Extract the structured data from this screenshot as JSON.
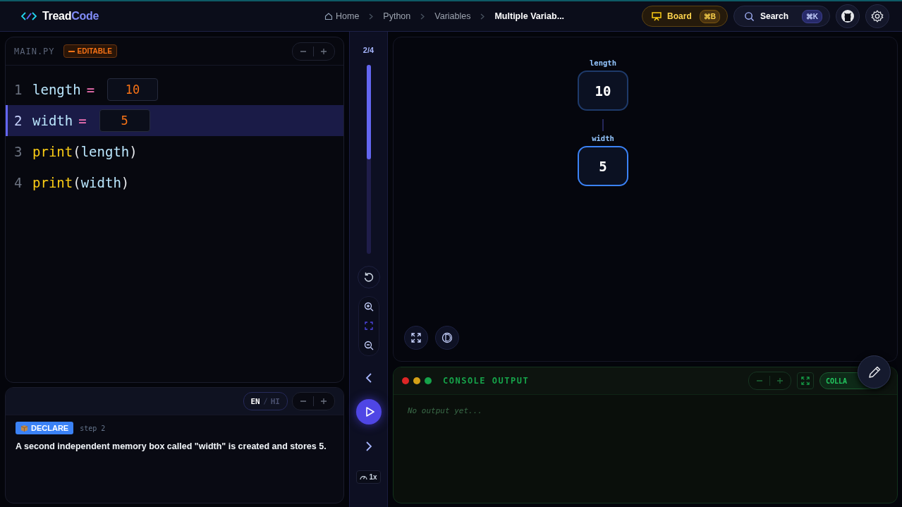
{
  "header": {
    "logo": {
      "part1": "Tread",
      "part2": "Code"
    },
    "breadcrumb": [
      {
        "label": "Home",
        "current": false
      },
      {
        "label": "Python",
        "current": false
      },
      {
        "label": "Variables",
        "current": false
      },
      {
        "label": "Multiple Variab...",
        "current": true
      }
    ],
    "board_button": {
      "label": "Board",
      "shortcut": "⌘B"
    },
    "search_button": {
      "label": "Search",
      "shortcut": "⌘K"
    }
  },
  "editor": {
    "filename": "MAIN.PY",
    "badge": "EDITABLE",
    "lines": [
      {
        "number": "1",
        "selected": false,
        "tokens": [
          {
            "kind": "var",
            "text": "length"
          },
          {
            "kind": "op",
            "text": "="
          },
          {
            "kind": "input",
            "text": "10"
          }
        ]
      },
      {
        "number": "2",
        "selected": true,
        "tokens": [
          {
            "kind": "var",
            "text": "width"
          },
          {
            "kind": "op",
            "text": "="
          },
          {
            "kind": "input",
            "text": "5"
          }
        ]
      },
      {
        "number": "3",
        "selected": false,
        "tokens": [
          {
            "kind": "func",
            "text": "print"
          },
          {
            "kind": "paren",
            "text": "("
          },
          {
            "kind": "var",
            "text": "length"
          },
          {
            "kind": "paren",
            "text": ")"
          }
        ]
      },
      {
        "number": "4",
        "selected": false,
        "tokens": [
          {
            "kind": "func",
            "text": "print"
          },
          {
            "kind": "paren",
            "text": "("
          },
          {
            "kind": "var",
            "text": "width"
          },
          {
            "kind": "paren",
            "text": ")"
          }
        ]
      }
    ]
  },
  "explanation": {
    "languages": [
      {
        "label": "EN",
        "selected": true
      },
      {
        "label": "HI",
        "selected": false
      }
    ],
    "tag": "DECLARE",
    "step": "step 2",
    "text": "A second independent memory box called \"width\" is created and stores 5."
  },
  "stepper": {
    "counter": "2/4",
    "level": 0.5,
    "speed": "1x"
  },
  "memory": [
    {
      "name": "length",
      "value": "10",
      "active": false
    },
    {
      "name": "width",
      "value": "5",
      "active": true
    }
  ],
  "console": {
    "title": "CONSOLE OUTPUT",
    "collapse_label": "COLLA",
    "placeholder": "No output yet..."
  }
}
